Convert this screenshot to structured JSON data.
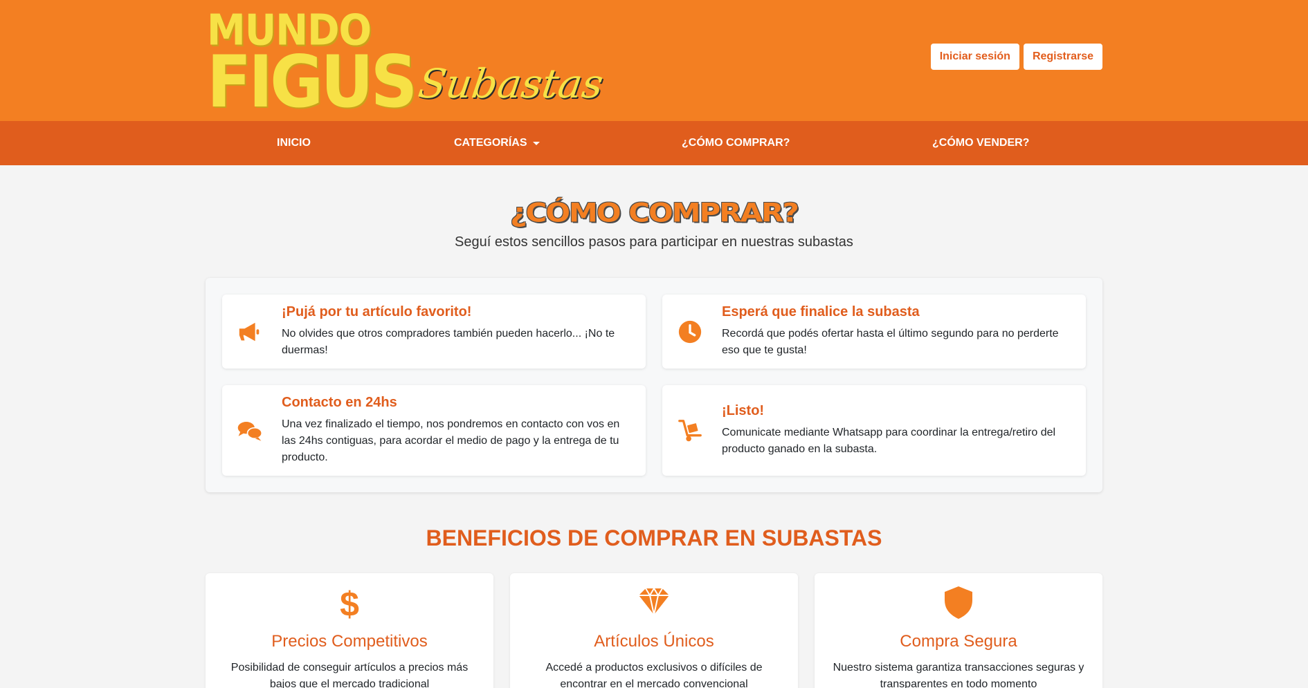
{
  "brand": {
    "line1": "MUNDO",
    "line2": "FIGUS",
    "script": "Subastas"
  },
  "auth": {
    "login": "Iniciar sesión",
    "register": "Registrarse"
  },
  "nav": {
    "items": [
      "INICIO",
      "CATEGORÍAS",
      "¿CÓMO COMPRAR?",
      "¿CÓMO VENDER?"
    ]
  },
  "hero": {
    "title": "¿CÓMO COMPRAR?",
    "subtitle": "Seguí estos sencillos pasos para participar en nuestras subastas"
  },
  "steps": [
    {
      "icon": "megaphone-icon",
      "title": "¡Pujá por tu artículo favorito!",
      "desc": "No olvides que otros compradores también pueden hacerlo... ¡No te duermas!"
    },
    {
      "icon": "clock-icon",
      "title": "Esperá que finalice la subasta",
      "desc": "Recordá que podés ofertar hasta el último segundo para no perderte eso que te gusta!"
    },
    {
      "icon": "chat-icon",
      "title": "Contacto en 24hs",
      "desc": "Una vez finalizado el tiempo, nos pondremos en contacto con vos en las 24hs contiguas, para acordar el medio de pago y la entrega de tu producto."
    },
    {
      "icon": "dolly-icon",
      "title": "¡Listo!",
      "desc": "Comunicate mediante Whatsapp para coordinar la entrega/retiro del producto ganado en la subasta."
    }
  ],
  "benefits_title": "BENEFICIOS DE COMPRAR EN SUBASTAS",
  "benefits": [
    {
      "icon": "dollar-icon",
      "title": "Precios Competitivos",
      "desc": "Posibilidad de conseguir artículos a precios más bajos que el mercado tradicional"
    },
    {
      "icon": "gem-icon",
      "title": "Artículos Únicos",
      "desc": "Accedé a productos exclusivos o difíciles de encontrar en el mercado convencional"
    },
    {
      "icon": "shield-icon",
      "title": "Compra Segura",
      "desc": "Nuestro sistema garantiza transacciones seguras y transparentes en todo momento"
    }
  ],
  "colors": {
    "header_bg": "#f37f22",
    "nav_bg": "#e05d1d",
    "accent": "#e05d1d",
    "icon": "#f37f22",
    "logo_yellow": "#f7e146"
  }
}
